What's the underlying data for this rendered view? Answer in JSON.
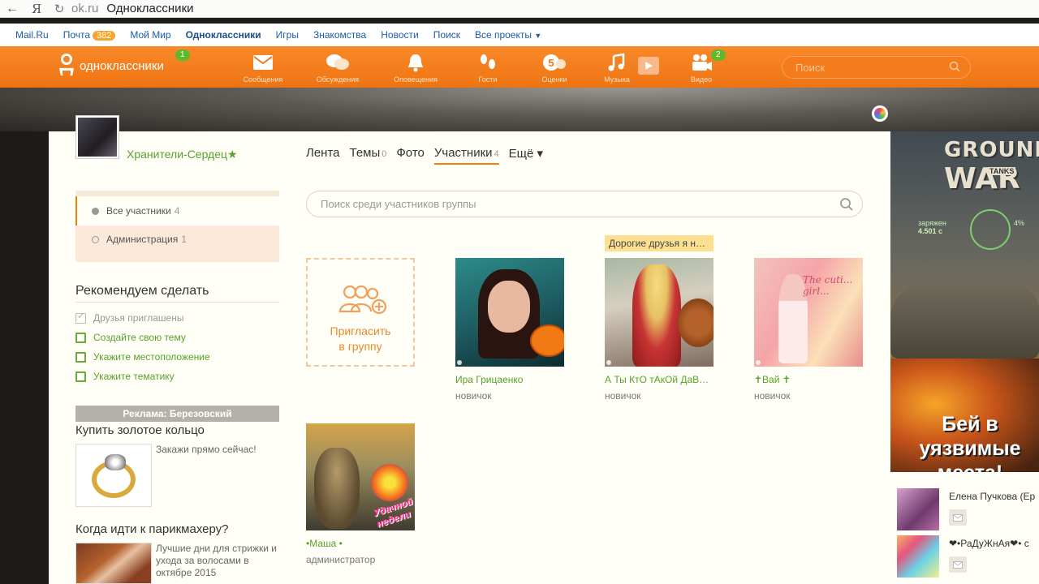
{
  "browser": {
    "domain": "ok.ru",
    "title": "Одноклассники",
    "ya_label": "Я"
  },
  "projects_bar": {
    "items": [
      {
        "label": "Mail.Ru"
      },
      {
        "label": "Почта",
        "badge": "382"
      },
      {
        "label": "Мой Мир"
      },
      {
        "label": "Одноклассники"
      },
      {
        "label": "Игры"
      },
      {
        "label": "Знакомства"
      },
      {
        "label": "Новости"
      },
      {
        "label": "Поиск"
      },
      {
        "label": "Все проекты"
      }
    ]
  },
  "toolbar": {
    "brand": "одноклассники",
    "brand_badge": "1",
    "items": [
      {
        "label": "Сообщения",
        "icon": "envelope-icon"
      },
      {
        "label": "Обсуждения",
        "icon": "chat-bubbles-icon"
      },
      {
        "label": "Оповещения",
        "icon": "bell-icon"
      },
      {
        "label": "Гости",
        "icon": "footprints-icon"
      },
      {
        "label": "Оценки",
        "icon": "rating-five-icon"
      },
      {
        "label": "Музыка",
        "icon": "music-note-icon"
      },
      {
        "label": "Видео",
        "icon": "video-camera-icon",
        "badge": "2"
      }
    ],
    "search_placeholder": "Поиск"
  },
  "group": {
    "name": "Хранители-Сердец★"
  },
  "tabs": [
    {
      "label": "Лента",
      "count": ""
    },
    {
      "label": "Темы",
      "count": "0"
    },
    {
      "label": "Фото",
      "count": ""
    },
    {
      "label": "Участники",
      "count": "4",
      "active": true
    },
    {
      "label": "Ещё ▾",
      "count": ""
    }
  ],
  "side_menu": {
    "all_label": "Все участники",
    "all_count": "4",
    "admin_label": "Администрация",
    "admin_count": "1"
  },
  "recommend": {
    "title": "Рекомендуем сделать",
    "items": [
      {
        "label": "Друзья приглашены",
        "done": true
      },
      {
        "label": "Создайте свою тему",
        "done": false
      },
      {
        "label": "Укажите местоположение",
        "done": false
      },
      {
        "label": "Укажите тематику",
        "done": false
      }
    ]
  },
  "ads": {
    "header": "Реклама: Березовский",
    "ad1_title": "Купить золотое кольцо",
    "ad1_text": "Закажи прямо сейчас!",
    "ad2_title": "Когда идти к парикмахеру?",
    "ad2_text": "Лучшие дни для стрижки и ухода за волосами в октябре 2015"
  },
  "member_search_placeholder": "Поиск среди участников группы",
  "invite_label_1": "Пригласить",
  "invite_label_2": "в группу",
  "members": [
    {
      "name": "Ира Грицаенко",
      "role": "новичок"
    },
    {
      "name": "А Ты КтО тАкОй ДаВ…",
      "role": "новичок",
      "status": "Дорогие друзья я н…"
    },
    {
      "name": "✝Вай ✝",
      "role": "новичок",
      "photo_text": "The cuti... girl..."
    },
    {
      "name": "•Маша •",
      "role": "администратор",
      "photo_text": "Удачной недели"
    }
  ],
  "right_ad": {
    "logo_line1": "GROUND",
    "logo_line2": "WAR",
    "logo_sub": "TANKS",
    "hud_left": "заряжен",
    "hud_value": "4.501 с",
    "hud_pct": "4%",
    "slogan": "Бей в уязвимые места!"
  },
  "friends": [
    {
      "name": "Елена Пучкова (Ер"
    },
    {
      "name": "❤•РаДуЖнАя❤• с"
    }
  ],
  "colors": {
    "ok_orange": "#ee8208",
    "link_green": "#59a22a",
    "mailru_blue": "#1a5ea8",
    "badge_green": "#5fb92b"
  }
}
